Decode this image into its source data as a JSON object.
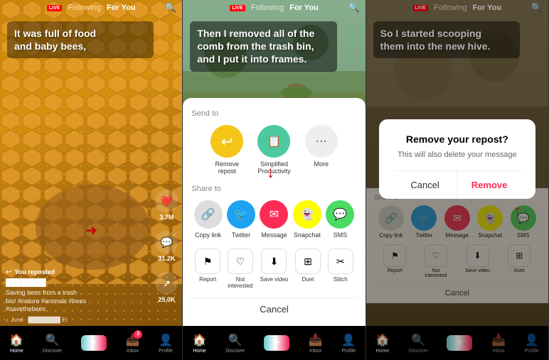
{
  "panels": [
    {
      "id": "panel1",
      "nav": {
        "live_label": "LIVE",
        "following_label": "Following",
        "foryou_label": "For You",
        "active": "foryou"
      },
      "caption": "It was full of food\nand baby bees,",
      "stats": {
        "likes": "3.7M",
        "comments": "31.2K",
        "shares": "25.0K"
      },
      "user": {
        "repost": "You reposted",
        "username": "████████",
        "description": "Saving bees from a trash\nbin! #nature #animals #bees\n#savethebees",
        "music": "♪ Jund · ████████ Et"
      },
      "bottom_nav": {
        "items": [
          "Home",
          "Discover",
          "",
          "Inbox",
          "Profile"
        ],
        "inbox_badge": "2"
      }
    },
    {
      "id": "panel2",
      "nav": {
        "live_label": "LIVE",
        "following_label": "Following",
        "foryou_label": "For You",
        "active": "foryou"
      },
      "caption": "Then I removed all of the\ncomb from the trash bin,\nand I put it into frames.",
      "share_sheet": {
        "send_to_title": "Send to",
        "send_to_items": [
          {
            "label": "Remove\nrepost",
            "icon": "↩",
            "color": "#f5c518",
            "bg": "#f5c518"
          },
          {
            "label": "Simplified\nProductivity",
            "icon": "📋",
            "color": "#4dc",
            "bg": "#4dcba0"
          },
          {
            "label": "More",
            "icon": "🔍",
            "color": "#999",
            "bg": "#eee"
          }
        ],
        "share_to_title": "Share to",
        "share_to_items": [
          {
            "label": "Copy link",
            "icon": "🔗",
            "bg": "#eee",
            "color": "#555"
          },
          {
            "label": "Twitter",
            "icon": "🐦",
            "bg": "#1da1f2",
            "color": "#fff"
          },
          {
            "label": "Message",
            "icon": "✉",
            "bg": "#fe2c55",
            "color": "#fff"
          },
          {
            "label": "Snapchat",
            "icon": "👻",
            "bg": "#fffc00",
            "color": "#000"
          },
          {
            "label": "SMS",
            "icon": "💬",
            "bg": "#4cd964",
            "color": "#fff"
          }
        ],
        "bottom_actions": [
          {
            "label": "Report",
            "icon": "⚑"
          },
          {
            "label": "Not\ninterested",
            "icon": "♡"
          },
          {
            "label": "Save video",
            "icon": "⬇"
          },
          {
            "label": "Duet",
            "icon": "⊞"
          },
          {
            "label": "Stitch",
            "icon": "✂"
          }
        ],
        "cancel_label": "Cancel"
      }
    },
    {
      "id": "panel3",
      "nav": {
        "live_label": "LIVE",
        "following_label": "Following",
        "foryou_label": "For You",
        "active": "foryou"
      },
      "caption": "So I started scooping\nthem into the new hive.",
      "dialog": {
        "title": "Remove your repost?",
        "subtitle": "This will also delete your message",
        "cancel_label": "Cancel",
        "remove_label": "Remove"
      },
      "share_to_title": "Share to",
      "share_to_items": [
        {
          "label": "Copy link",
          "icon": "🔗",
          "bg": "#eee"
        },
        {
          "label": "Twitter",
          "icon": "🐦",
          "bg": "#1da1f2"
        },
        {
          "label": "Message",
          "icon": "✉",
          "bg": "#fe2c55"
        },
        {
          "label": "Snapchat",
          "icon": "👻",
          "bg": "#fffc00"
        },
        {
          "label": "SMS",
          "icon": "💬",
          "bg": "#4cd964"
        }
      ],
      "bottom_actions": [
        {
          "label": "Report",
          "icon": "⚑"
        },
        {
          "label": "Not interested",
          "icon": "♡"
        },
        {
          "label": "Save video",
          "icon": "⬇"
        },
        {
          "label": "Duet",
          "icon": "⊞"
        }
      ],
      "cancel_label": "Cancel"
    }
  ]
}
